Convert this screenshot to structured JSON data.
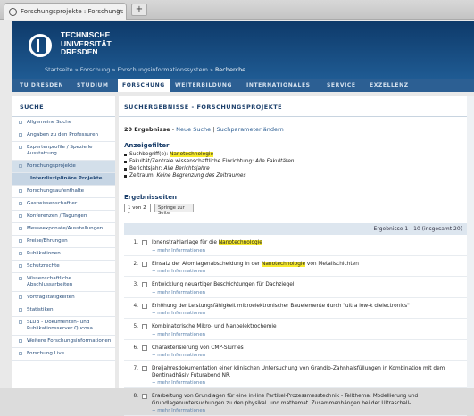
{
  "browser": {
    "tab_title": "Forschungsprojekte : Forschungs",
    "tab_close": "×",
    "new_tab": "+"
  },
  "header": {
    "logo_lines": [
      "TECHNISCHE",
      "UNIVERSITÄT",
      "DRESDEN"
    ],
    "breadcrumb": [
      "Startseite",
      "Forschung",
      "Forschungsinformationssystem",
      "Recherche"
    ],
    "breadcrumb_sep": "»"
  },
  "nav": [
    "TU DRESDEN",
    "STUDIUM",
    "FORSCHUNG",
    "WEITERBILDUNG",
    "INTERNATIONALES",
    "SERVICE",
    "EXZELLENZ"
  ],
  "sidebar": {
    "title": "SUCHE",
    "items": [
      "Allgemeine Suche",
      "Angaben zu den Professuren",
      "Expertenprofile / Spezielle Ausstattung",
      "Forschungsprojekte",
      "Interdisziplinäre Projekte",
      "Forschungsaufenthalte",
      "Gastwissenschaftler",
      "Konferenzen / Tagungen",
      "Messeexponate/Ausstellungen",
      "Preise/Ehrungen",
      "Publikationen",
      "Schutzrechte",
      "Wissenschaftliche Abschlussarbeiten",
      "Vortragstätigkeiten",
      "Statistiken",
      "SLUB - Dokumenten- und Publikationsserver Qucosa",
      "Weitere Forschungsinformationen",
      "Forschung Live"
    ]
  },
  "main": {
    "title": "SUCHERGEBNISSE - FORSCHUNGSPROJEKTE",
    "count": "20 Ergebnisse",
    "count_sep": " - ",
    "new_search": "Neue Suche",
    "pipe": " | ",
    "change_params": "Suchparameter ändern",
    "filter_title": "Anzeigefilter",
    "filters": [
      {
        "label": "Suchbegriff(e): ",
        "value": "Nanotechnologie"
      },
      {
        "label": "Fakultät/Zentrale wissenschaftliche Einrichtung: ",
        "value": "Alle Fakultäten"
      },
      {
        "label": "Berichtsjahr: ",
        "value": "Alle Berichtsjahre"
      },
      {
        "label": "Zeitraum: ",
        "value": "Keine Begrenzung des Zeitraumes"
      }
    ],
    "pages_title": "Ergebnisseiten",
    "page_select": "1 von 2",
    "jump_button": "Springe zur Seite",
    "results_range": "Ergebnisse 1 - 10 (insgesamt 20)",
    "more_label": "+ mehr Informationen",
    "results": [
      {
        "n": "1.",
        "pre": "Ionenstrahlanlage für die ",
        "hl": "Nanotechnologie",
        "post": ""
      },
      {
        "n": "2.",
        "pre": "Einsatz der Atomlagenabscheidung in der ",
        "hl": "Nanotechnologie",
        "post": " von Metallschichten"
      },
      {
        "n": "3.",
        "pre": "Entwicklung neuartiger Beschichtungen für Dachziegel",
        "hl": "",
        "post": ""
      },
      {
        "n": "4.",
        "pre": "Erhöhung der Leistungsfähigkeit mikroelektronischer Bauelemente durch \"ultra low-k dielectronics\"",
        "hl": "",
        "post": ""
      },
      {
        "n": "5.",
        "pre": "Kombinatorische Mikro- und Nanoelektrochemie",
        "hl": "",
        "post": ""
      },
      {
        "n": "6.",
        "pre": "Charakterisierung von CMP-Slurries",
        "hl": "",
        "post": ""
      },
      {
        "n": "7.",
        "pre": "Dreijahresdokumentation einer klinischen Untersuchung von Grandio-Zahnhalsfüllungen in Kombination mit dem Dentinadhäsiv Futurabond NR.",
        "hl": "",
        "post": ""
      },
      {
        "n": "8.",
        "pre": "Erarbeitung von Grundlagen für eine in-line Partikel-Prozessmesstechnik - Tellthema: Modellierung und Grundlagenuntersuchungen zu den physikal. und mathemat. Zusammenhängen bei der Ultraschall-",
        "hl": "",
        "post": ""
      }
    ]
  }
}
